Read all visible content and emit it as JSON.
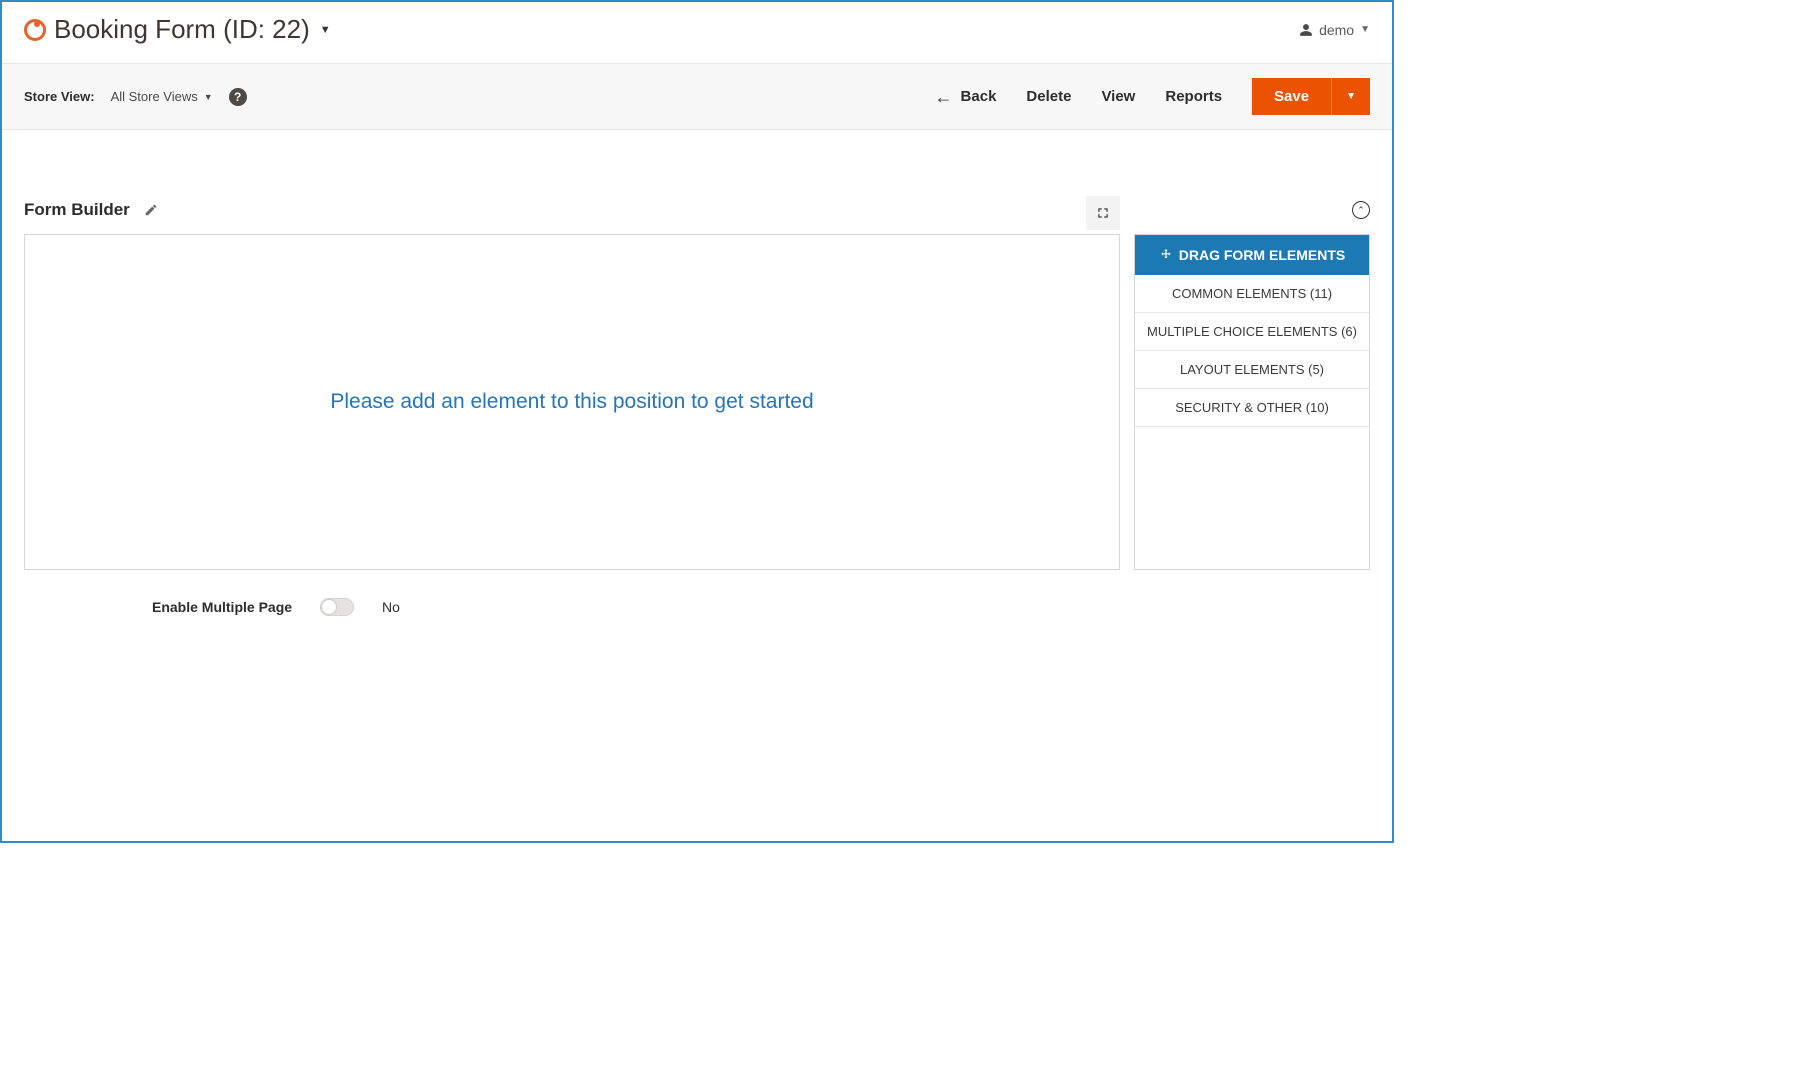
{
  "header": {
    "title": "Booking Form (ID: 22)",
    "user_name": "demo"
  },
  "toolbar": {
    "store_view_label": "Store View:",
    "store_view_value": "All Store Views",
    "actions": {
      "back": "Back",
      "delete": "Delete",
      "view": "View",
      "reports": "Reports",
      "save": "Save"
    }
  },
  "section": {
    "title": "Form Builder",
    "placeholder_text": "Please add an element to this position to get started"
  },
  "palette": {
    "header": "DRAG FORM ELEMENTS",
    "groups": [
      "COMMON ELEMENTS (11)",
      "MULTIPLE CHOICE ELEMENTS (6)",
      "LAYOUT ELEMENTS (5)",
      "SECURITY & OTHER (10)"
    ]
  },
  "options": {
    "enable_multiple_page_label": "Enable Multiple Page",
    "enable_multiple_page_value": "No"
  }
}
